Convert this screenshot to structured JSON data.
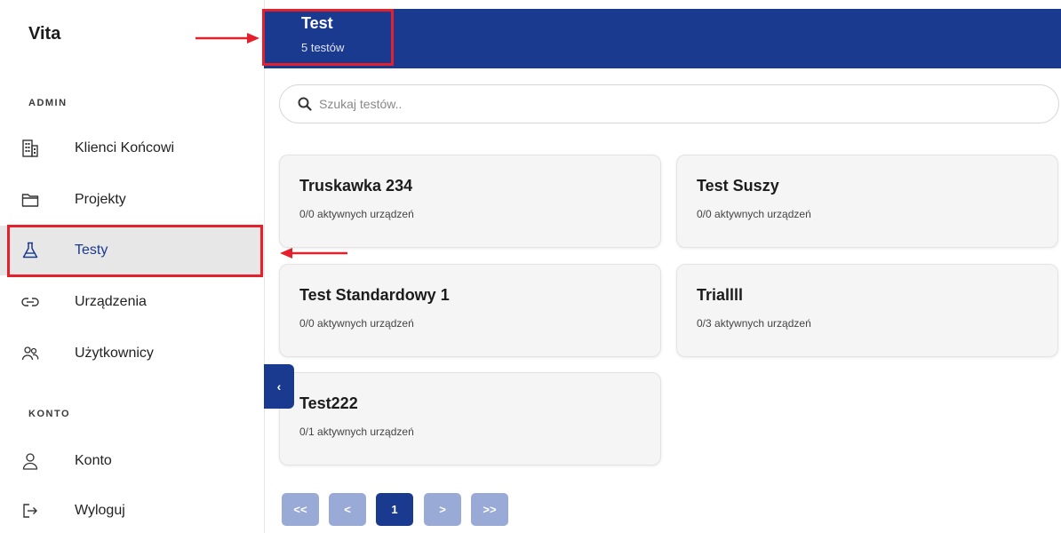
{
  "sidebar": {
    "brand": "Vita",
    "sections": [
      {
        "label": "ADMIN"
      },
      {
        "label": "KONTO"
      }
    ],
    "items": [
      {
        "label": "Klienci Końcowi",
        "icon": "building-icon"
      },
      {
        "label": "Projekty",
        "icon": "folder-icon"
      },
      {
        "label": "Testy",
        "icon": "flask-icon",
        "active": true
      },
      {
        "label": "Urządzenia",
        "icon": "link-icon"
      },
      {
        "label": "Użytkownicy",
        "icon": "users-icon"
      },
      {
        "label": "Konto",
        "icon": "user-icon"
      },
      {
        "label": "Wyloguj",
        "icon": "logout-icon"
      }
    ]
  },
  "header": {
    "title": "Test",
    "subtitle": "5 testów"
  },
  "search": {
    "placeholder": "Szukaj testów.."
  },
  "cards": [
    {
      "title": "Truskawka 234",
      "meta": "0/0 aktywnych urządzeń"
    },
    {
      "title": "Test Suszy",
      "meta": "0/0 aktywnych urządzeń"
    },
    {
      "title": "Test Standardowy 1",
      "meta": "0/0 aktywnych urządzeń"
    },
    {
      "title": "Triallll",
      "meta": "0/3 aktywnych urządzeń"
    },
    {
      "title": "Test222",
      "meta": "0/1 aktywnych urządzeń"
    }
  ],
  "collapse": {
    "glyph": "‹"
  },
  "pagination": {
    "first": "<<",
    "prev": "<",
    "current": "1",
    "next": ">",
    "last": ">>"
  },
  "colors": {
    "primary": "#1a3a8f",
    "annotation_red": "#e3202b",
    "page_inactive": "#9aaad6"
  }
}
